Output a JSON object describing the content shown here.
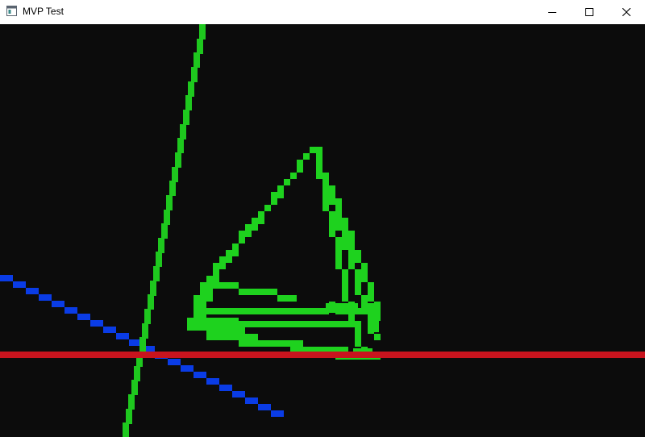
{
  "window": {
    "title": "MVP Test",
    "icon": "window-app-icon",
    "controls": {
      "minimize_icon": "minimize-icon",
      "maximize_icon": "maximize-icon",
      "close_icon": "close-icon"
    }
  },
  "scene": {
    "background": "#0c0c0c",
    "colors": {
      "x_axis": "#c8141e",
      "y_axis": "#1ec81e",
      "z_axis": "#0a3ce6",
      "model": "#1ed21e"
    }
  }
}
